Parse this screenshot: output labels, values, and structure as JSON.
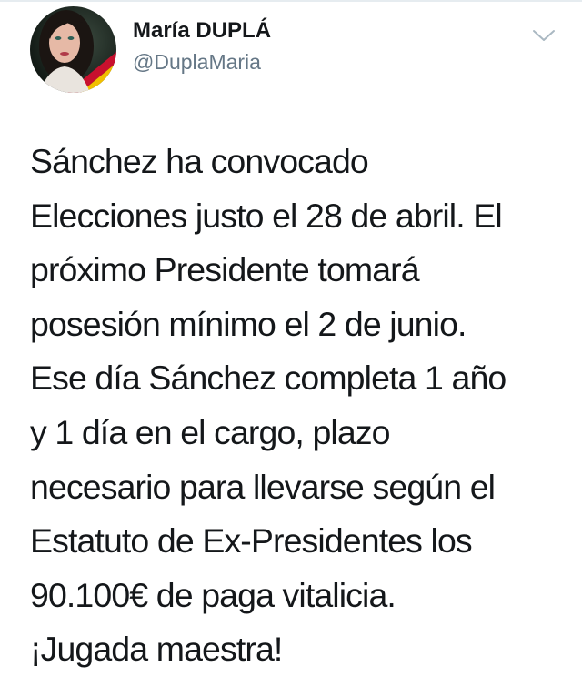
{
  "tweet": {
    "author": {
      "display_name": "María DUPLÁ",
      "handle": "@DuplaMaria",
      "avatar_icon": "profile-photo"
    },
    "menu_icon": "chevron-down-icon",
    "text": "Sánchez ha convocado\nElecciones justo el 28 de abril. El\npróximo Presidente tomará\nposesión mínimo el 2 de junio.\nEse día Sánchez completa 1 año\ny 1 día en el cargo, plazo\nnecesario para llevarse según el\nEstatuto de Ex-Presidentes los\n90.100€ de paga vitalicia.\n¡Jugada maestra!"
  },
  "colors": {
    "text_primary": "#14171a",
    "text_secondary": "#657786",
    "divider": "#e6ecf0",
    "caret": "#aab8c2"
  }
}
